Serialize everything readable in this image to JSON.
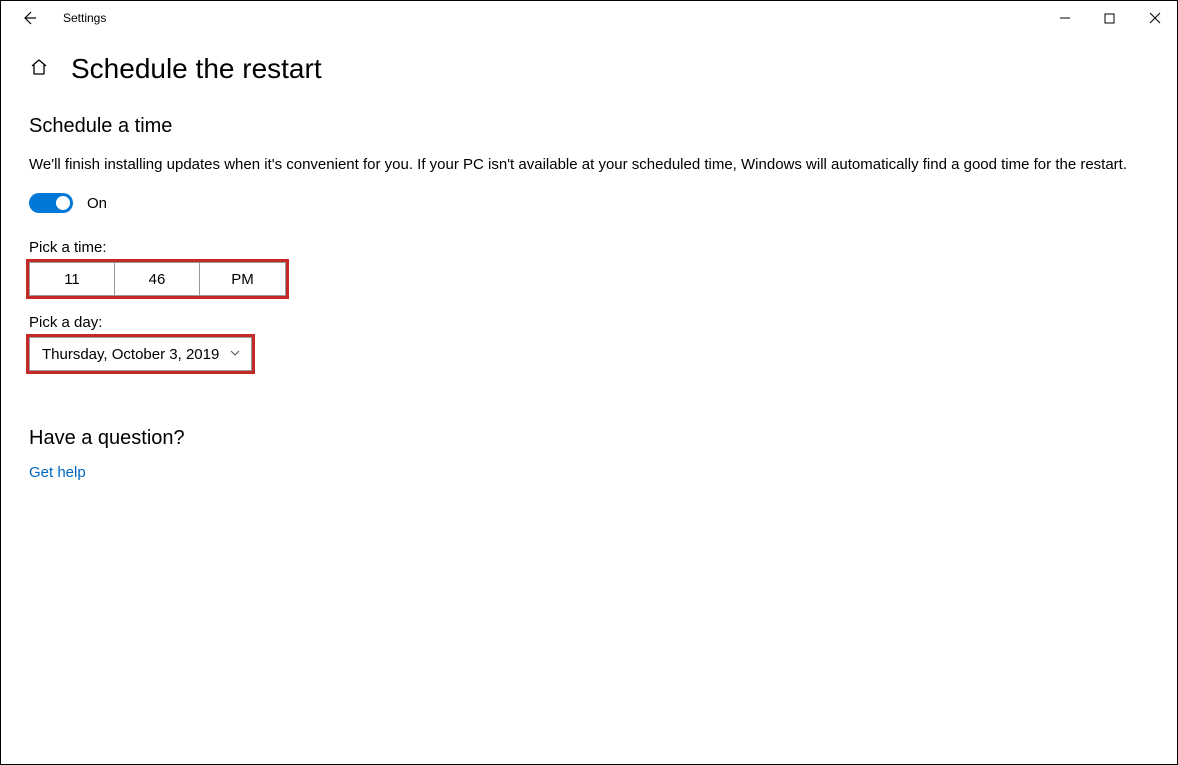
{
  "titlebar": {
    "title": "Settings"
  },
  "header": {
    "page_title": "Schedule the restart"
  },
  "section1": {
    "title": "Schedule a time",
    "desc": "We'll finish installing updates when it's convenient for you. If your PC isn't available at your scheduled time, Windows will automatically find a good time for the restart.",
    "toggle_label": "On",
    "pick_time_label": "Pick a time:",
    "time": {
      "hour": "11",
      "minute": "46",
      "ampm": "PM"
    },
    "pick_day_label": "Pick a day:",
    "day": "Thursday, October 3, 2019"
  },
  "help": {
    "title": "Have a question?",
    "link": "Get help"
  }
}
